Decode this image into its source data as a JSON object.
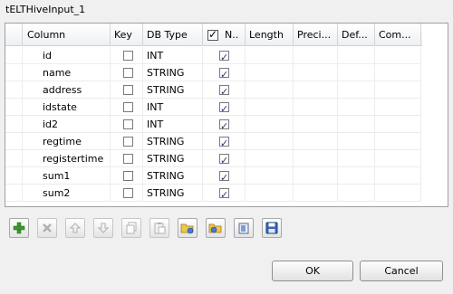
{
  "dialog": {
    "title": "tELTHiveInput_1"
  },
  "table": {
    "columns": [
      "Column",
      "Key",
      "DB Type",
      "N..",
      "Length",
      "Preci...",
      "Def...",
      "Com..."
    ],
    "rows": [
      {
        "column": "id",
        "key": false,
        "db_type": "INT",
        "nullable": true
      },
      {
        "column": "name",
        "key": false,
        "db_type": "STRING",
        "nullable": true
      },
      {
        "column": "address",
        "key": false,
        "db_type": "STRING",
        "nullable": true
      },
      {
        "column": "idstate",
        "key": false,
        "db_type": "INT",
        "nullable": true
      },
      {
        "column": "id2",
        "key": false,
        "db_type": "INT",
        "nullable": true
      },
      {
        "column": "regtime",
        "key": false,
        "db_type": "STRING",
        "nullable": true
      },
      {
        "column": "registertime",
        "key": false,
        "db_type": "STRING",
        "nullable": true
      },
      {
        "column": "sum1",
        "key": false,
        "db_type": "STRING",
        "nullable": true
      },
      {
        "column": "sum2",
        "key": false,
        "db_type": "STRING",
        "nullable": true
      }
    ],
    "nullable_header_checked": true
  },
  "toolbar": {
    "icons": [
      "add-icon",
      "remove-icon",
      "move-up-icon",
      "move-down-icon",
      "copy-icon",
      "paste-icon",
      "import-icon",
      "export-icon",
      "reset-icon",
      "save-icon"
    ]
  },
  "buttons": {
    "ok": "OK",
    "cancel": "Cancel"
  },
  "colors": {
    "add_green": "#3a9a2a",
    "disabled_gray": "#b0b0b0",
    "check_blue": "#1e3c78"
  }
}
